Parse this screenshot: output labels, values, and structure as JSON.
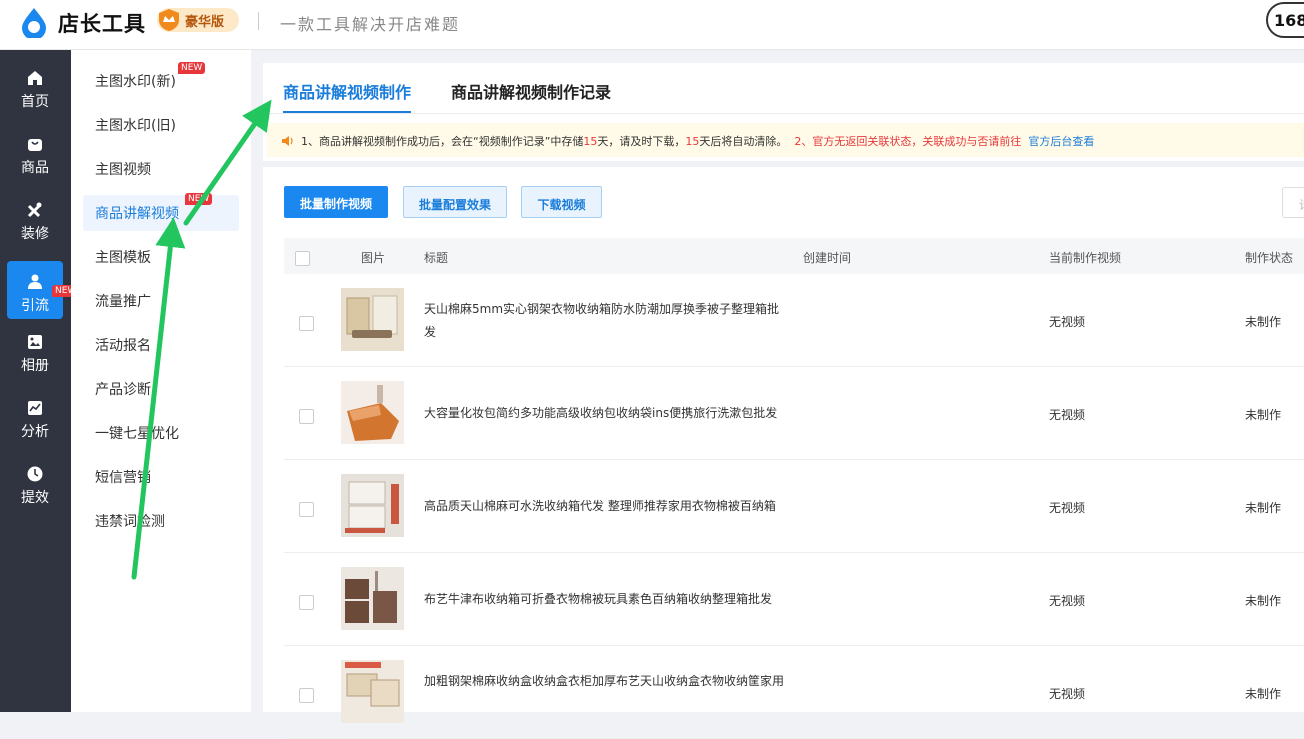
{
  "header": {
    "app_name": "店长工具",
    "vip_label": "豪华版",
    "slogan": "一款工具解决开店难题",
    "credit": "168"
  },
  "nav": {
    "items": [
      {
        "label": "首页",
        "icon": "home-icon"
      },
      {
        "label": "商品",
        "icon": "bag-icon"
      },
      {
        "label": "装修",
        "icon": "tools-icon"
      },
      {
        "label": "引流",
        "icon": "user-icon",
        "active": true,
        "badge": "NEW"
      },
      {
        "label": "相册",
        "icon": "image-icon"
      },
      {
        "label": "分析",
        "icon": "chart-icon"
      },
      {
        "label": "提效",
        "icon": "clock-icon"
      }
    ]
  },
  "submenu": {
    "items": [
      {
        "label": "主图水印(新)",
        "badge": "NEW"
      },
      {
        "label": "主图水印(旧)"
      },
      {
        "label": "主图视频"
      },
      {
        "label": "商品讲解视频",
        "badge": "NEW",
        "active": true
      },
      {
        "label": "主图模板"
      },
      {
        "label": "流量推广"
      },
      {
        "label": "活动报名"
      },
      {
        "label": "产品诊断"
      },
      {
        "label": "一键七星优化"
      },
      {
        "label": "短信营销"
      },
      {
        "label": "违禁词检测"
      }
    ]
  },
  "tabs": [
    {
      "label": "商品讲解视频制作",
      "active": true
    },
    {
      "label": "商品讲解视频制作记录"
    }
  ],
  "notice": {
    "p1": "1、商品讲解视频制作成功后，会在“视频制作记录”中存储",
    "days1": "15",
    "p2": "天，请及时下载，",
    "days2": "15",
    "p3": "天后将自动清除。",
    "p4": "2、官方无返回关联状态，关联成功与否请前往",
    "link": "官方后台查看"
  },
  "toolbar": {
    "batch_make": "批量制作视频",
    "batch_config": "批量配置效果",
    "download": "下载视频",
    "search_placeholder": "请"
  },
  "table": {
    "headers": {
      "image": "图片",
      "title": "标题",
      "created": "创建时间",
      "current_video": "当前制作视频",
      "status": "制作状态"
    },
    "rows": [
      {
        "title": "天山棉麻5mm实心钢架衣物收纳箱防水防潮加厚换季被子整理箱批发",
        "created": "",
        "video": "无视频",
        "status": "未制作"
      },
      {
        "title": "大容量化妆包简约多功能高级收纳包收纳袋ins便携旅行洗漱包批发",
        "created": "",
        "video": "无视频",
        "status": "未制作"
      },
      {
        "title": "高品质天山棉麻可水洗收纳箱代发 整理师推荐家用衣物棉被百纳箱",
        "created": "",
        "video": "无视频",
        "status": "未制作"
      },
      {
        "title": "布艺牛津布收纳箱可折叠衣物棉被玩具素色百纳箱收纳整理箱批发",
        "created": "",
        "video": "无视频",
        "status": "未制作"
      },
      {
        "title": "加粗钢架棉麻收纳盒收纳盒衣柜加厚布艺天山收纳盒衣物收纳筐家用",
        "created": "",
        "video": "无视频",
        "status": "未制作"
      }
    ]
  },
  "colors": {
    "primary": "#1a88ee",
    "sidebar_dark": "#2f3440",
    "annotation_arrow": "#22c55e",
    "badge_red": "#e8363b"
  }
}
